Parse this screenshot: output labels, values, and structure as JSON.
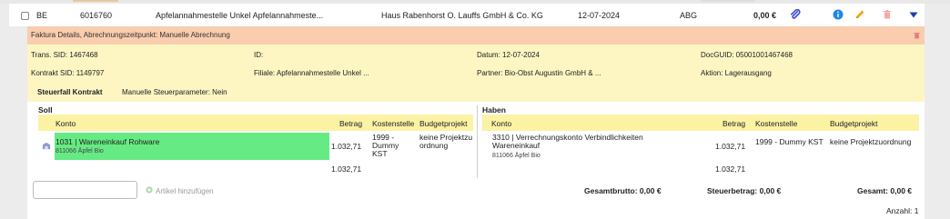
{
  "row": {
    "type": "BE",
    "number": "6016760",
    "location": "Apfelannahmestelle Unkel Apfelannahmeste...",
    "partner": "Haus Rabenhorst O. Lauffs GmbH & Co. KG",
    "date": "12-07-2024",
    "code": "ABG",
    "amount": "0,00 €"
  },
  "details": {
    "header": "Faktura Details, Abrechnungszeitpunkt: Manuelle Abrechnung",
    "trans_sid": "Trans. SID: 1467468",
    "id": "ID:",
    "datum": "Datum: 12-07-2024",
    "docguid": "DocGUID: 05001001467468",
    "kontrakt_sid": "Kontrakt SID: 1149797",
    "filiale": "Filiale: Apfelannahmestelle Unkel ...",
    "partner": "Partner: Bio-Obst Augustin GmbH & ...",
    "aktion": "Aktion: Lagerausgang",
    "steuerfall": "Steuerfall Kontrakt",
    "steuerparameter": "Manuelle Steuerparameter: Nein"
  },
  "soll": {
    "title": "Soll",
    "headers": {
      "konto": "Konto",
      "betrag": "Betrag",
      "kostenstelle": "Kostenstelle",
      "budget": "Budgetprojekt"
    },
    "row": {
      "konto": "1031 | Wareneinkauf Rohware",
      "sub": "811066 Äpfel Bio",
      "betrag": "1.032,71",
      "kostenstelle": "1999 - Dummy KST",
      "budget": "keine Projektzuordnung"
    },
    "total": "1.032,71"
  },
  "haben": {
    "title": "Haben",
    "headers": {
      "konto": "Konto",
      "betrag": "Betrag",
      "kostenstelle": "Kostenstelle",
      "budget": "Budgetprojekt"
    },
    "row": {
      "konto": "3310 | Verrechnungskonto Verbindlichkeiten Wareneinkauf",
      "sub": "811066 Äpfel Bio",
      "betrag": "1.032,71",
      "kostenstelle": "1999 - Dummy KST",
      "budget": "keine Projektzuordnung"
    },
    "total": "1.032,71"
  },
  "footer": {
    "add_article": "Artikel hinzufügen",
    "gesamtbrutto": "Gesamtbrutto: 0,00 €",
    "steuerbetrag": "Steuerbetrag: 0,00 €",
    "gesamt": "Gesamt: 0,00 €",
    "anzahl": "Anzahl: 1"
  },
  "colors": {
    "accent": "#f9cdae",
    "yellow": "#fdf6c3",
    "green": "#66ea84",
    "header_yellow": "#fbf2a4",
    "info": "#1e88e5"
  }
}
